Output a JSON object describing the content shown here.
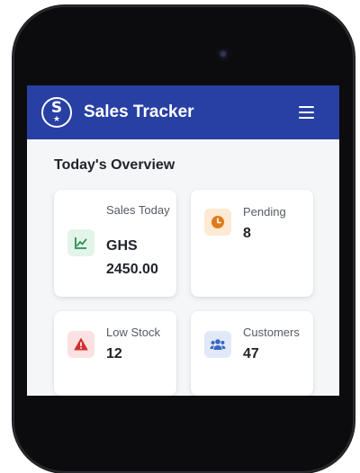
{
  "app": {
    "title": "Sales Tracker",
    "logo_letter": "S",
    "logo_star": "★",
    "accent_color": "#2840a3"
  },
  "overview": {
    "title": "Today's Overview",
    "cards": [
      {
        "label": "Sales Today",
        "value": "GHS 2450.00",
        "icon": "chart-line-icon",
        "icon_color": "#2e8b57",
        "icon_bg": "#e3f5e8"
      },
      {
        "label": "Pending",
        "value": "8",
        "icon": "clock-icon",
        "icon_color": "#e07b1a",
        "icon_bg": "#fde9d4"
      },
      {
        "label": "Low Stock",
        "value": "12",
        "icon": "warning-icon",
        "icon_color": "#d32f2f",
        "icon_bg": "#fbe1e1"
      },
      {
        "label": "Customers",
        "value": "47",
        "icon": "users-icon",
        "icon_color": "#3a66c4",
        "icon_bg": "#e1e9f8"
      }
    ]
  }
}
